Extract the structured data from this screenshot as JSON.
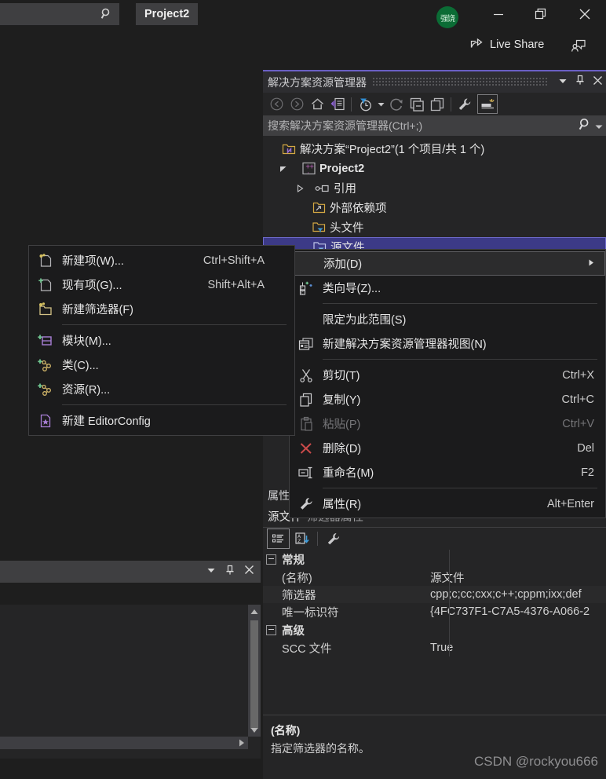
{
  "titlebar": {
    "quick_search_placeholder": "",
    "project_tab": "Project2",
    "avatar_initials": "强饶",
    "minimize_label": "最小化",
    "maximize_label": "还原",
    "close_label": "关闭"
  },
  "toolbar2": {
    "live_share": "Live Share",
    "feedback": "发送反馈"
  },
  "solution_explorer": {
    "title": "解决方案资源管理器",
    "search_placeholder": "搜索解决方案资源管理器(Ctrl+;)",
    "toolbar_icons": [
      "back-icon",
      "forward-icon",
      "home-icon",
      "sync-with-active-document-icon",
      "pending-changes-filter-icon",
      "refresh-icon",
      "collapse-all-icon",
      "show-all-files-icon",
      "properties-icon",
      "preview-selected-items-icon"
    ],
    "tree": [
      {
        "label": "解决方案“Project2”(1 个项目/共 1 个)",
        "icon": "solution-icon",
        "indent": 0,
        "twisty": "none",
        "bold": false,
        "selected": false
      },
      {
        "label": "Project2",
        "icon": "cpp-project-icon",
        "indent": 1,
        "twisty": "expanded",
        "bold": true,
        "selected": false
      },
      {
        "label": "引用",
        "icon": "references-icon",
        "indent": 2,
        "twisty": "collapsed",
        "bold": false,
        "selected": false
      },
      {
        "label": "外部依赖项",
        "icon": "external-dependencies-icon",
        "indent": 2,
        "twisty": "none",
        "bold": false,
        "selected": false
      },
      {
        "label": "头文件",
        "icon": "filter-folder-icon",
        "indent": 2,
        "twisty": "none",
        "bold": false,
        "selected": false
      },
      {
        "label": "源文件",
        "icon": "filter-folder-icon",
        "indent": 2,
        "twisty": "none",
        "bold": false,
        "selected": true
      }
    ]
  },
  "context_menu": {
    "items": [
      {
        "label": "添加(D)",
        "shortcut": "",
        "icon": "",
        "submenu": true,
        "highlighted": true,
        "disabled": false
      },
      {
        "label": "类向导(Z)...",
        "shortcut": "",
        "icon": "class-wizard-icon",
        "submenu": false,
        "highlighted": false,
        "disabled": false
      },
      {
        "separator": true
      },
      {
        "label": "限定为此范围(S)",
        "shortcut": "",
        "icon": "",
        "submenu": false,
        "highlighted": false,
        "disabled": false
      },
      {
        "label": "新建解决方案资源管理器视图(N)",
        "shortcut": "",
        "icon": "new-solution-explorer-view-icon",
        "submenu": false,
        "highlighted": false,
        "disabled": false
      },
      {
        "separator": true
      },
      {
        "label": "剪切(T)",
        "shortcut": "Ctrl+X",
        "icon": "cut-icon",
        "submenu": false,
        "highlighted": false,
        "disabled": false
      },
      {
        "label": "复制(Y)",
        "shortcut": "Ctrl+C",
        "icon": "copy-icon",
        "submenu": false,
        "highlighted": false,
        "disabled": false
      },
      {
        "label": "粘贴(P)",
        "shortcut": "Ctrl+V",
        "icon": "paste-icon",
        "submenu": false,
        "highlighted": false,
        "disabled": true
      },
      {
        "label": "删除(D)",
        "shortcut": "Del",
        "icon": "delete-x-icon",
        "submenu": false,
        "highlighted": false,
        "disabled": false
      },
      {
        "label": "重命名(M)",
        "shortcut": "F2",
        "icon": "rename-icon",
        "submenu": false,
        "highlighted": false,
        "disabled": false
      },
      {
        "separator": true
      },
      {
        "label": "属性(R)",
        "shortcut": "Alt+Enter",
        "icon": "wrench-icon",
        "submenu": false,
        "highlighted": false,
        "disabled": false
      }
    ]
  },
  "submenu": {
    "items": [
      {
        "label": "新建项(W)...",
        "shortcut": "Ctrl+Shift+A",
        "icon": "new-item-icon"
      },
      {
        "label": "现有项(G)...",
        "shortcut": "Shift+Alt+A",
        "icon": "existing-item-icon"
      },
      {
        "label": "新建筛选器(F)",
        "shortcut": "",
        "icon": "new-filter-icon"
      },
      {
        "separator": true
      },
      {
        "label": "模块(M)...",
        "shortcut": "",
        "icon": "add-module-icon"
      },
      {
        "label": "类(C)...",
        "shortcut": "",
        "icon": "add-class-icon"
      },
      {
        "label": "资源(R)...",
        "shortcut": "",
        "icon": "add-resource-icon"
      },
      {
        "separator": true
      },
      {
        "label": "新建 EditorConfig",
        "shortcut": "",
        "icon": "editorconfig-icon"
      }
    ]
  },
  "properties": {
    "title": "属性",
    "object_name": "源文件",
    "object_type": "筛选器属性",
    "toolbar_icons": [
      "categorized-icon",
      "alphabetical-icon",
      "property-pages-icon"
    ],
    "groups": [
      {
        "name": "常规",
        "rows": [
          {
            "key": "(名称)",
            "value": "源文件"
          },
          {
            "key": "筛选器",
            "value": "cpp;c;cc;cxx;c++;cppm;ixx;def"
          },
          {
            "key": "唯一标识符",
            "value": "{4FC737F1-C7A5-4376-A066-2"
          }
        ]
      },
      {
        "name": "高级",
        "rows": [
          {
            "key": "SCC 文件",
            "value": "True"
          }
        ]
      }
    ],
    "description_title": "(名称)",
    "description_text": "指定筛选器的名称。"
  },
  "watermark": "CSDN @rockyou666",
  "colors": {
    "window_bg": "#1e1e1e",
    "panel_bg": "#252526",
    "header_bg": "#2d2d30",
    "input_bg": "#3f3f41",
    "menu_bg": "#1b1b1c",
    "selection": "#3c3a87",
    "selection_border": "#6d69c9",
    "accent_purple": "#6a5fc4",
    "text": "#e4e4e4",
    "text_dim": "#9d9d9f",
    "avatar_green": "#0b6c35",
    "delete_red": "#c94a4a"
  }
}
